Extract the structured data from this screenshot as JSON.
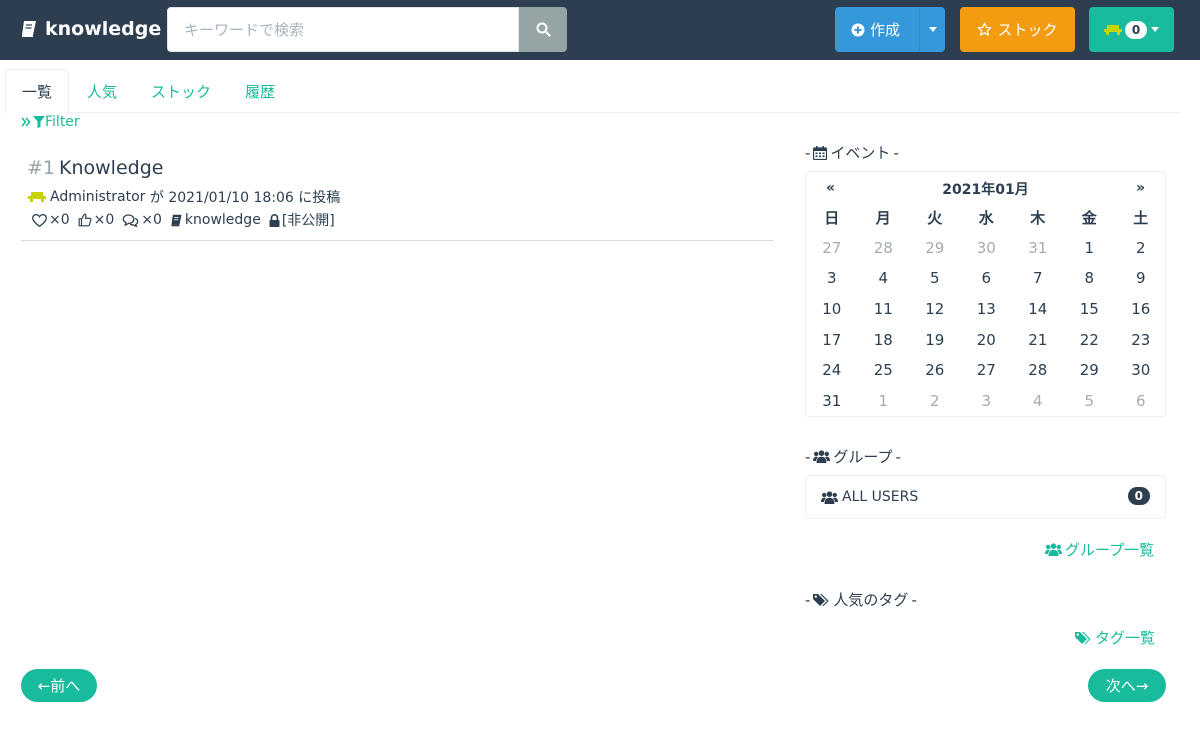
{
  "navbar": {
    "brand": "knowledge",
    "search_placeholder": "キーワードで検索",
    "create_label": "作成",
    "stock_label": "ストック",
    "notification_count": "0"
  },
  "tabs": [
    {
      "label": "一覧",
      "active": true
    },
    {
      "label": "人気"
    },
    {
      "label": "ストック"
    },
    {
      "label": "履歴"
    }
  ],
  "filter": {
    "label": "Filter"
  },
  "article": {
    "number": "#1",
    "title": "Knowledge",
    "author": "Administrator",
    "posted_text": "が 2021/01/10 18:06 に投稿",
    "likes": "×0",
    "points": "×0",
    "comments": "×0",
    "template": "knowledge",
    "visibility": "[非公開]"
  },
  "events": {
    "title": "イベント",
    "month": "2021年01月",
    "prev": "«",
    "next": "»",
    "weekdays": [
      "日",
      "月",
      "火",
      "水",
      "木",
      "金",
      "土"
    ],
    "days": [
      [
        "27",
        "28",
        "29",
        "30",
        "31",
        "1",
        "2"
      ],
      [
        "3",
        "4",
        "5",
        "6",
        "7",
        "8",
        "9"
      ],
      [
        "10",
        "11",
        "12",
        "13",
        "14",
        "15",
        "16"
      ],
      [
        "17",
        "18",
        "19",
        "20",
        "21",
        "22",
        "23"
      ],
      [
        "24",
        "25",
        "26",
        "27",
        "28",
        "29",
        "30"
      ],
      [
        "31",
        "1",
        "2",
        "3",
        "4",
        "5",
        "6"
      ]
    ]
  },
  "groups": {
    "title": "グループ",
    "items": [
      {
        "name": "ALL USERS",
        "count": "0"
      }
    ],
    "list_link": "グループ一覧"
  },
  "tags": {
    "title": "人気のタグ",
    "list_link": "タグ一覧"
  },
  "pager": {
    "prev": "←前へ",
    "next": "次へ→"
  },
  "colors": {
    "navbar": "#2c3e50",
    "primary": "#3498db",
    "warning": "#f39c12",
    "success": "#18bc9c"
  }
}
